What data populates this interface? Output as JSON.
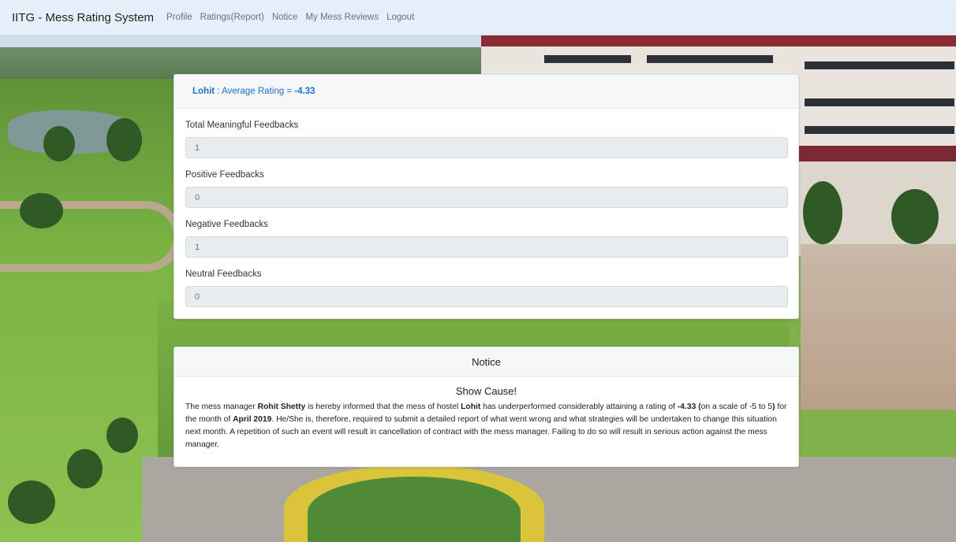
{
  "navbar": {
    "brand": "IITG - Mess Rating System",
    "links": [
      "Profile",
      "Ratings(Report)",
      "Notice",
      "My Mess Reviews",
      "Logout"
    ]
  },
  "rating_card": {
    "hostel": "Lohit",
    "separator": " : Average Rating = ",
    "average_rating": "-4.33",
    "fields": [
      {
        "label": "Total Meaningful Feedbacks",
        "value": "1"
      },
      {
        "label": "Positive Feedbacks",
        "value": "0"
      },
      {
        "label": "Negative Feedbacks",
        "value": "1"
      },
      {
        "label": "Neutral Feedbacks",
        "value": "0"
      }
    ]
  },
  "notice_card": {
    "header": "Notice",
    "title": "Show Cause!",
    "text": {
      "p1": "The mess manager ",
      "manager": "Rohit Shetty",
      "p2": " is hereby informed that the mess of hostel ",
      "hostel": "Lohit",
      "p3": " has underperformed considerably attaining a rating of ",
      "rating": "-4.33 (",
      "p4": "on a scale of -5 to 5",
      "p5": ")",
      "p6": " for the month of ",
      "month": "April 2019",
      "p7": ". He/She is, therefore, required to submit a detailed report of what went wrong and what strategies will be undertaken to change this situation next month. A repetition of such an event will result in cancellation of contract with the mess manager. Failing to do so will result in serious action against the mess manager."
    }
  },
  "colors": {
    "accent": "#1a73d9",
    "navbar_bg": "#e5f0fa",
    "input_bg": "#e9ecef"
  }
}
